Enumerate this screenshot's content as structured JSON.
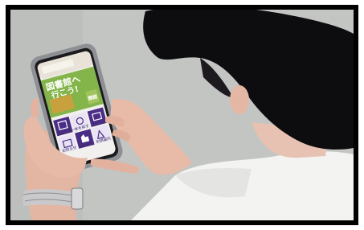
{
  "photo": {
    "subject": "person-holding-smartphone",
    "colors": {
      "background_wall": "#c3c5c2",
      "hair": "#0d0c0e",
      "shirt": "#f4f4f2",
      "skin": "#e5b9a6",
      "phone_body": "#8e8f95",
      "app_banner": "#84b54b",
      "app_tile_purple": "#4a2d86",
      "app_tile_light": "#e9e3f4"
    }
  },
  "phone_app": {
    "banner_text_line1": "図書館へ",
    "banner_text_line2": "行こう!",
    "side_badge_text": "開館",
    "tile_labels": [
      "カレンダー",
      "本を探す",
      "イベント",
      "お知らせ",
      "Twitter",
      "利用案内"
    ]
  },
  "watch": {
    "icon": "wristwatch-icon"
  }
}
